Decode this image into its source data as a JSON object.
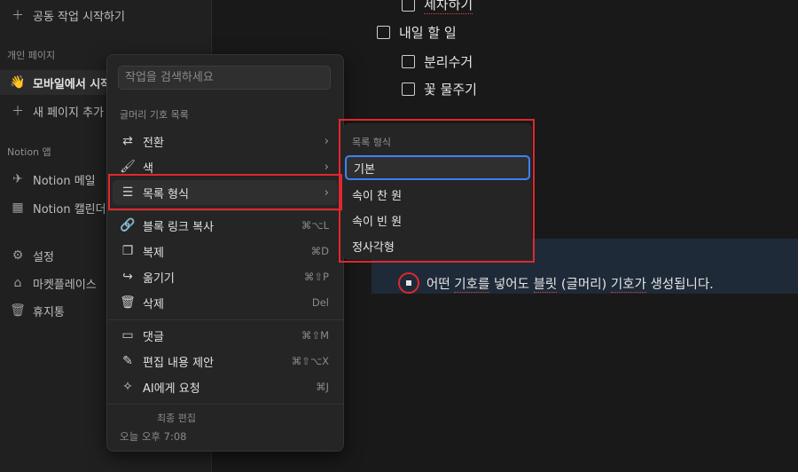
{
  "sidebar": {
    "top_item": "공동 작업 시작하기",
    "section_private": "개인 페이지",
    "page_emoji": "👋",
    "page_title": "모바일에서 시작",
    "new_page": "새 페이지 추가",
    "section_apps": "Notion 앱",
    "apps": [
      {
        "label": "Notion 메일",
        "icon": "send-icon"
      },
      {
        "label": "Notion 캘린더",
        "icon": "calendar-icon"
      }
    ],
    "bottom": [
      {
        "label": "설정",
        "icon": "gear-icon"
      },
      {
        "label": "마켓플레이스",
        "icon": "marketplace-icon"
      },
      {
        "label": "휴지통",
        "icon": "trash-icon"
      }
    ]
  },
  "content": {
    "todos": [
      "세차하기",
      "내일 할 일",
      "분리수거",
      "꽃 물주기"
    ],
    "bullet_text_parts": [
      "어떤 ",
      "기호를",
      " 넣어도 ",
      "블릿",
      " (글머리) ",
      "기호가",
      " 생성됩니다."
    ]
  },
  "menu": {
    "search_placeholder": "작업을 검색하세요",
    "section": "글머리 기호 목록",
    "items_top": [
      {
        "label": "전환",
        "icon": "turn-into-icon",
        "arrow": "›"
      },
      {
        "label": "색",
        "icon": "paint-roller-icon",
        "arrow": "›"
      },
      {
        "label": "목록 형식",
        "icon": "list-icon",
        "arrow": "›"
      }
    ],
    "items_mid": [
      {
        "label": "블록 링크 복사",
        "icon": "link-icon",
        "shortcut": "⌘⌥L"
      },
      {
        "label": "복제",
        "icon": "duplicate-icon",
        "shortcut": "⌘D"
      },
      {
        "label": "옮기기",
        "icon": "move-icon",
        "shortcut": "⌘⇧P"
      },
      {
        "label": "삭제",
        "icon": "trash-icon",
        "shortcut": "Del"
      }
    ],
    "items_bottom": [
      {
        "label": "댓글",
        "icon": "comment-icon",
        "shortcut": "⌘⇧M"
      },
      {
        "label": "편집 내용 제안",
        "icon": "suggest-edit-icon",
        "shortcut": "⌘⇧⌥X"
      },
      {
        "label": "AI에게 요청",
        "icon": "ai-icon",
        "shortcut": "⌘J"
      }
    ],
    "footer_label": "최종 편집",
    "footer_time": "오늘 오후 7:08"
  },
  "submenu": {
    "title": "목록 형식",
    "options": [
      "기본",
      "속이 찬 원",
      "속이 빈 원",
      "정사각형"
    ],
    "selected": "기본"
  },
  "colors": {
    "annotation_red": "#e0282e",
    "selection_blue": "#3b82f6"
  }
}
